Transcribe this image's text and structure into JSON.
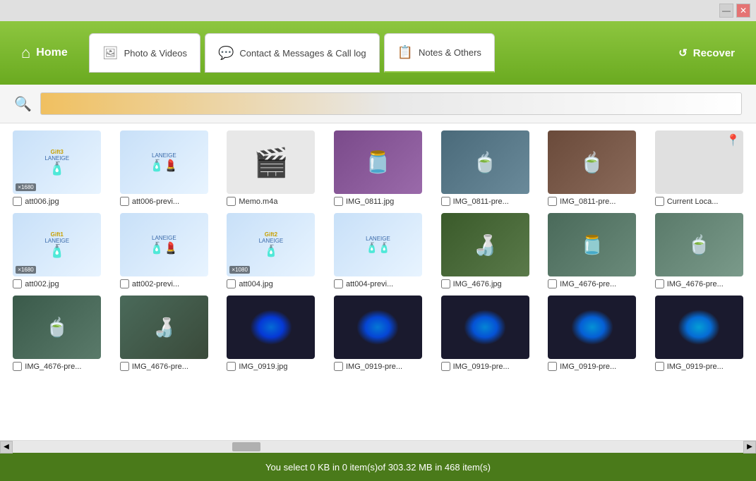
{
  "titleBar": {
    "minimizeLabel": "—",
    "closeLabel": "✕"
  },
  "header": {
    "homeLabel": "Home",
    "recoverLabel": "Recover",
    "tabs": [
      {
        "id": "photo",
        "label": "Photo & Videos",
        "icon": "🖼"
      },
      {
        "id": "contact",
        "label": "Contact & Messages & Call log",
        "icon": "💬"
      },
      {
        "id": "notes",
        "label": "Notes & Others",
        "icon": "📋",
        "active": true
      }
    ]
  },
  "search": {
    "placeholder": "",
    "iconLabel": "🔍"
  },
  "statusBar": {
    "text": "You select 0 KB in 0 item(s)of 303.32 MB in 468 item(s)"
  },
  "grid": {
    "items": [
      {
        "label": "att006.jpg",
        "type": "laneige",
        "badge": "×1680"
      },
      {
        "label": "att006-previ...",
        "type": "laneige2"
      },
      {
        "label": "Memo.m4a",
        "type": "video"
      },
      {
        "label": "IMG_0811.jpg",
        "type": "purple-dish"
      },
      {
        "label": "IMG_0811-pre...",
        "type": "teal-bowl"
      },
      {
        "label": "IMG_0811-pre...",
        "type": "brown-bowl"
      },
      {
        "label": "Current Loca...",
        "type": "pin"
      },
      {
        "label": "att002.jpg",
        "type": "laneige3",
        "badge": "×1680"
      },
      {
        "label": "att002-previ...",
        "type": "laneige4"
      },
      {
        "label": "att004.jpg",
        "type": "laneige5",
        "badge": "×1080"
      },
      {
        "label": "att004-previ...",
        "type": "laneige6"
      },
      {
        "label": "IMG_4676.jpg",
        "type": "drinks"
      },
      {
        "label": "IMG_4676-pre...",
        "type": "drinks2"
      },
      {
        "label": "IMG_4676-pre...",
        "type": "drinks3"
      },
      {
        "label": "IMG_4676-pre...",
        "type": "dark-still"
      },
      {
        "label": "IMG_4676-pre...",
        "type": "dark-still2"
      },
      {
        "label": "IMG_0919.jpg",
        "type": "mouse"
      },
      {
        "label": "IMG_0919-pre...",
        "type": "mouse2"
      },
      {
        "label": "IMG_0919-pre...",
        "type": "mouse3"
      },
      {
        "label": "IMG_0919-pre...",
        "type": "mouse4"
      },
      {
        "label": "IMG_0919-pre...",
        "type": "mouse5"
      }
    ]
  }
}
